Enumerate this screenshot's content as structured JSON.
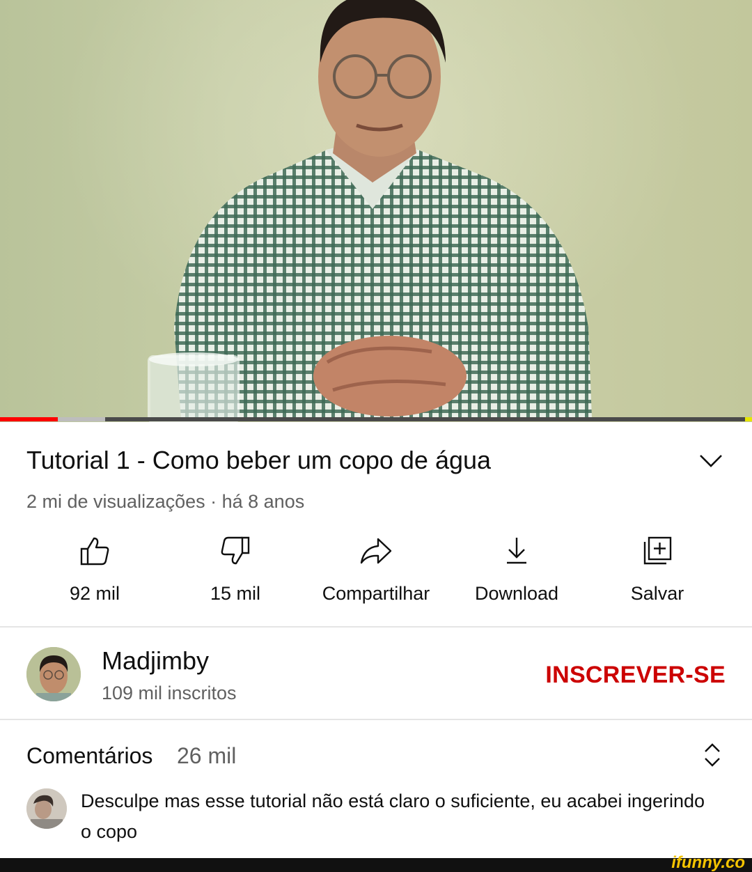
{
  "player": {
    "progress_played": 0.077,
    "progress_buffered": 0.14
  },
  "video": {
    "title": "Tutorial 1 - Como beber um copo de água",
    "meta": "2 mi de visualizações · há 8 anos"
  },
  "actions": {
    "like": {
      "label": "92 mil",
      "icon": "thumbs-up-icon"
    },
    "dislike": {
      "label": "15 mil",
      "icon": "thumbs-down-icon"
    },
    "share": {
      "label": "Compartilhar",
      "icon": "share-icon"
    },
    "download": {
      "label": "Download",
      "icon": "download-icon"
    },
    "save": {
      "label": "Salvar",
      "icon": "add-to-playlist-icon"
    }
  },
  "channel": {
    "name": "Madjimby",
    "subscribers": "109 mil inscritos",
    "subscribe_label": "INSCREVER-SE"
  },
  "comments": {
    "label": "Comentários",
    "count": "26 mil",
    "top_comment": "Desculpe mas esse tutorial não está claro o suficiente, eu acabei ingerindo o copo"
  },
  "watermark": "ifunny.co",
  "colors": {
    "subscribe": "#cc0000",
    "progress": "#ff0000",
    "secondary_text": "#606060"
  }
}
